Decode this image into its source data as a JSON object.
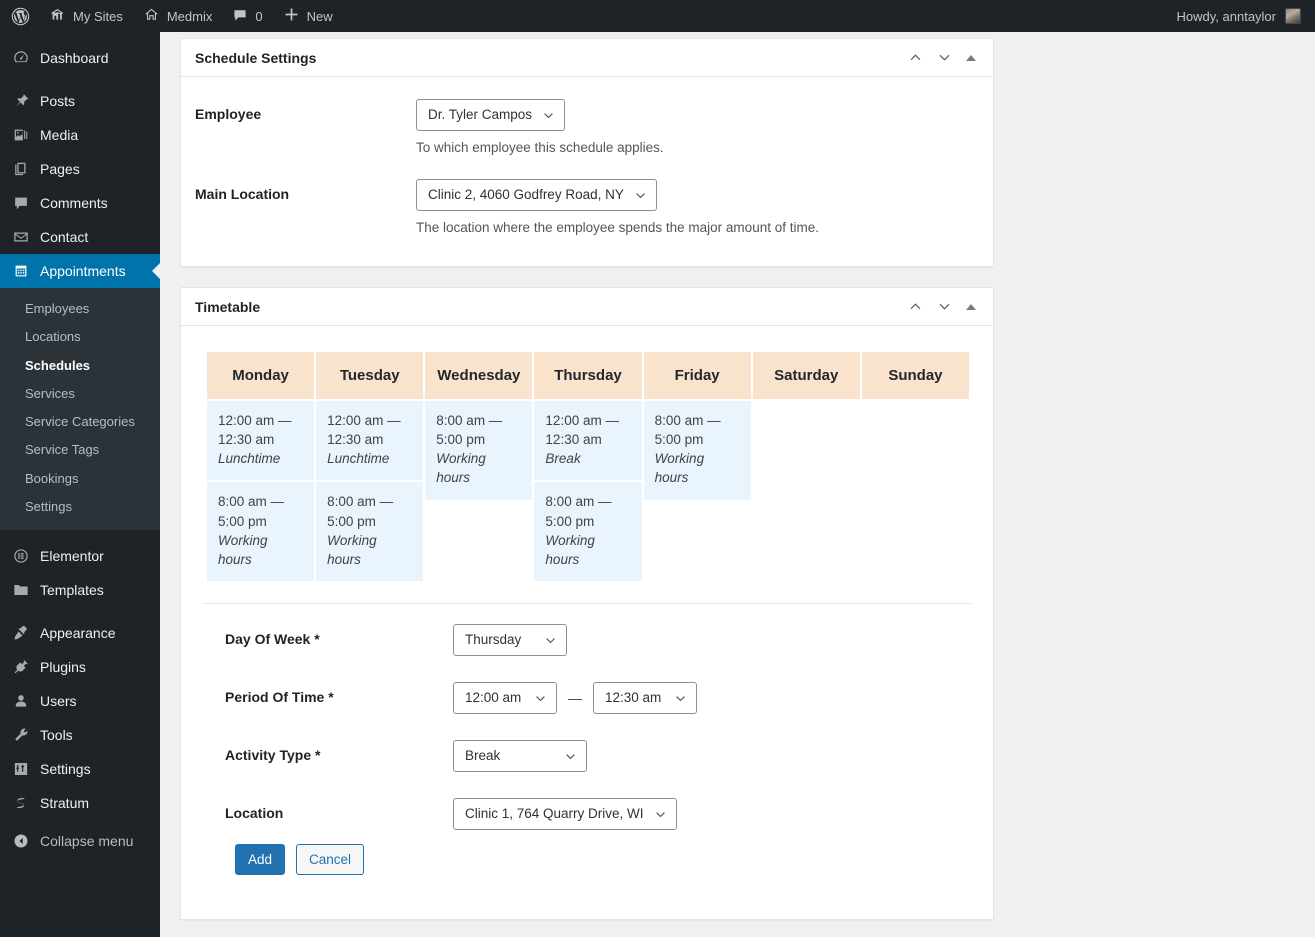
{
  "adminbar": {
    "logo_icon": "wordpress-logo-icon",
    "my_sites": {
      "label": "My Sites",
      "icon": "sites-icon"
    },
    "site": {
      "label": "Medmix",
      "icon": "home-icon"
    },
    "comments": {
      "count": "0",
      "icon": "comment-bubble-icon"
    },
    "new": {
      "label": "New",
      "icon": "plus-icon"
    },
    "howdy": "Howdy, anntaylor"
  },
  "sidebar": {
    "items": [
      {
        "label": "Dashboard",
        "icon": "dashboard-icon"
      },
      {
        "label": "Posts",
        "icon": "pin-icon"
      },
      {
        "label": "Media",
        "icon": "media-icon"
      },
      {
        "label": "Pages",
        "icon": "pages-icon"
      },
      {
        "label": "Comments",
        "icon": "comment-icon"
      },
      {
        "label": "Contact",
        "icon": "envelope-icon"
      },
      {
        "label": "Appointments",
        "icon": "calendar-icon"
      }
    ],
    "submenu": [
      {
        "label": "Employees"
      },
      {
        "label": "Locations"
      },
      {
        "label": "Schedules"
      },
      {
        "label": "Services"
      },
      {
        "label": "Service Categories"
      },
      {
        "label": "Service Tags"
      },
      {
        "label": "Bookings"
      },
      {
        "label": "Settings"
      }
    ],
    "plugins_group": [
      {
        "label": "Elementor",
        "icon": "elementor-icon"
      },
      {
        "label": "Templates",
        "icon": "folder-icon"
      }
    ],
    "bottom_items": [
      {
        "label": "Appearance",
        "icon": "brush-icon"
      },
      {
        "label": "Plugins",
        "icon": "plug-icon"
      },
      {
        "label": "Users",
        "icon": "user-icon"
      },
      {
        "label": "Tools",
        "icon": "wrench-icon"
      },
      {
        "label": "Settings",
        "icon": "sliders-icon"
      },
      {
        "label": "Stratum",
        "icon": "stratum-icon"
      }
    ],
    "collapse": {
      "label": "Collapse menu",
      "icon": "collapse-arrow-icon"
    }
  },
  "schedule_settings": {
    "title": "Schedule Settings",
    "employee": {
      "label": "Employee",
      "value": "Dr. Tyler Campos",
      "description": "To which employee this schedule applies."
    },
    "main_location": {
      "label": "Main Location",
      "value": "Clinic 2, 4060 Godfrey Road, NY",
      "description": "The location where the employee spends the major amount of time."
    }
  },
  "timetable": {
    "title": "Timetable",
    "days": [
      "Monday",
      "Tuesday",
      "Wednesday",
      "Thursday",
      "Friday",
      "Saturday",
      "Sunday"
    ],
    "entries": [
      [
        {
          "time": "12:00 am — 12:30 am",
          "activity": "Lunchtime"
        },
        {
          "time": "8:00 am — 5:00 pm",
          "activity": "Working hours"
        }
      ],
      [
        {
          "time": "12:00 am — 12:30 am",
          "activity": "Lunchtime"
        },
        {
          "time": "8:00 am — 5:00 pm",
          "activity": "Working hours"
        }
      ],
      [
        {
          "time": "8:00 am — 5:00 pm",
          "activity": "Working hours"
        }
      ],
      [
        {
          "time": "12:00 am — 12:30 am",
          "activity": "Break"
        },
        {
          "time": "8:00 am — 5:00 pm",
          "activity": "Working hours"
        }
      ],
      [
        {
          "time": "8:00 am — 5:00 pm",
          "activity": "Working hours"
        }
      ],
      [],
      []
    ]
  },
  "form": {
    "day_of_week": {
      "label": "Day Of Week",
      "required": "*",
      "value": "Thursday"
    },
    "period_of_time": {
      "label": "Period Of Time",
      "required": "*",
      "from": "12:00 am",
      "to": "12:30 am",
      "separator": "—"
    },
    "activity_type": {
      "label": "Activity Type",
      "required": "*",
      "value": "Break"
    },
    "location": {
      "label": "Location",
      "value": "Clinic 1, 764 Quarry Drive, WI"
    },
    "add_label": "Add",
    "cancel_label": "Cancel"
  },
  "colors": {
    "admin_dark": "#1d2327",
    "accent_blue": "#0073aa",
    "primary_button": "#2271b1",
    "day_header": "#f9e3cd",
    "cell_blue": "#eaf4fd"
  }
}
